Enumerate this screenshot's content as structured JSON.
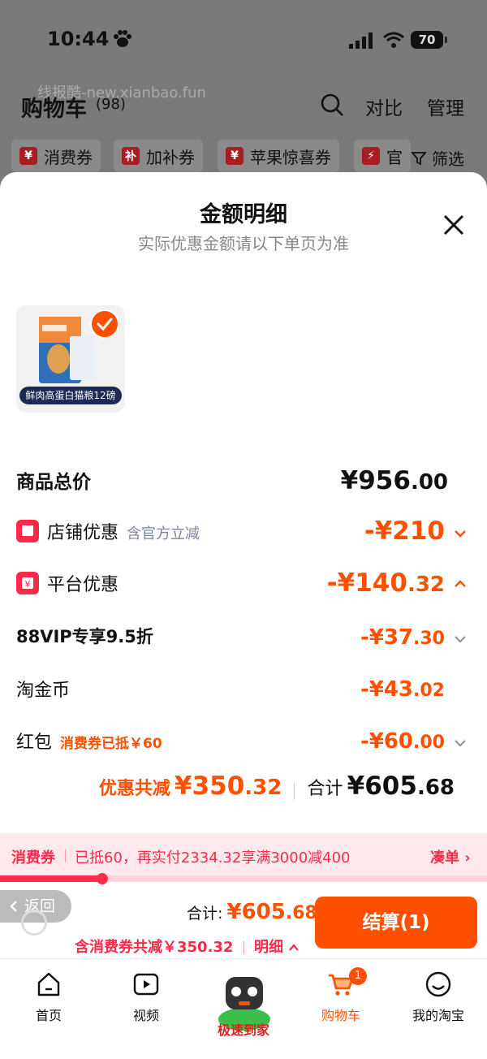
{
  "status_bar": {
    "time": "10:44",
    "battery": "70"
  },
  "watermark": "线报酷-new.xianbao.fun",
  "header": {
    "title": "购物车",
    "count": "(98)",
    "compare": "对比",
    "manage": "管理"
  },
  "chips": [
    {
      "badge": "¥",
      "label": "消费券"
    },
    {
      "badge": "补",
      "label": "加补券"
    },
    {
      "badge": "¥",
      "label": "苹果惊喜券"
    },
    {
      "badge": "⚡",
      "label": "官"
    }
  ],
  "filter": "筛选",
  "sheet": {
    "title": "金额明细",
    "subtitle": "实际优惠金额请以下单页为准",
    "product_label": "鲜肉高蛋白猫粮12磅",
    "rows": {
      "total": {
        "label": "商品总价",
        "int": "¥956",
        "dec": ".00"
      },
      "shop": {
        "label": "店铺优惠",
        "sub": "含官方立减",
        "int": "-¥210",
        "dec": ""
      },
      "platform": {
        "label": "平台优惠",
        "int": "-¥140",
        "dec": ".32"
      },
      "vip": {
        "label": "88VIP专享9.5折",
        "int": "-¥37",
        "dec": ".30"
      },
      "coin": {
        "label": "淘金币",
        "int": "-¥43",
        "dec": ".02"
      },
      "redpacket": {
        "label": "红包",
        "sub": "消费券已抵￥60",
        "int": "-¥60",
        "dec": ".00"
      }
    },
    "summary": {
      "label": "优惠共减",
      "disc_int": "¥350",
      "disc_dec": ".32",
      "total_label": "合计",
      "total_int": "¥605",
      "total_dec": ".68"
    }
  },
  "banner": {
    "tag": "消费券",
    "text": "已抵60，再实付2334.32享满3000减400",
    "link": "凑单 ›",
    "progress": 0.21
  },
  "checkout": {
    "back": "返回",
    "total_label": "合计:",
    "total_int": "¥605",
    "total_dec": ".68",
    "discount_text": "含消费券共减￥350.32",
    "detail": "明细",
    "button": "结算(1)"
  },
  "tabs": [
    {
      "icon": "home-icon",
      "label": "首页"
    },
    {
      "icon": "video-icon",
      "label": "视频"
    },
    {
      "icon": "mascot-icon",
      "label": "极速到家"
    },
    {
      "icon": "cart-icon",
      "label": "购物车",
      "badge": "1"
    },
    {
      "icon": "profile-icon",
      "label": "我的淘宝"
    }
  ],
  "colors": {
    "accent": "#ff5000",
    "red": "#ff2a4a",
    "overlay": "#7a7a7a"
  }
}
